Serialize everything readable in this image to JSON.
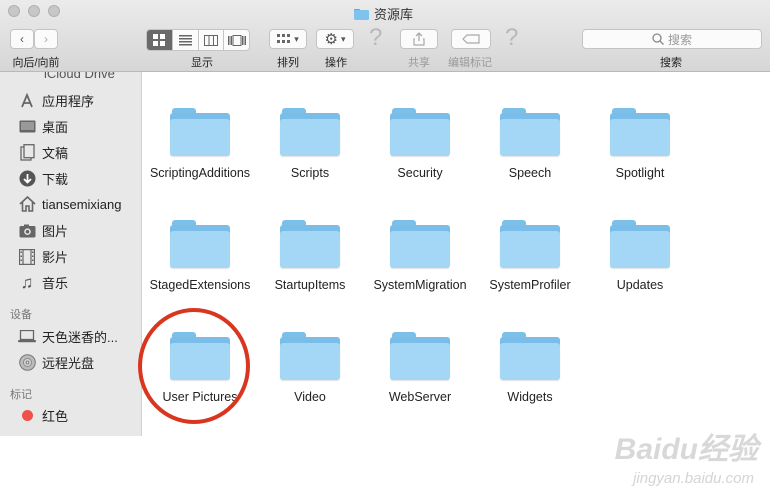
{
  "window": {
    "title": "资源库"
  },
  "toolbar": {
    "back_forward_label": "向后/向前",
    "view_label": "显示",
    "arrange_label": "排列",
    "action_label": "操作",
    "share_label": "共享",
    "edit_tags_label": "编辑标记",
    "search_label": "搜索",
    "search_placeholder": "搜索"
  },
  "sidebar": {
    "partial_top": "iCloud Drive",
    "favorites": [
      {
        "label": "应用程序",
        "icon": "applications-icon"
      },
      {
        "label": "桌面",
        "icon": "desktop-icon"
      },
      {
        "label": "文稿",
        "icon": "documents-icon"
      },
      {
        "label": "下载",
        "icon": "downloads-icon"
      },
      {
        "label": "tiansemixiang",
        "icon": "home-icon"
      },
      {
        "label": "图片",
        "icon": "pictures-icon"
      },
      {
        "label": "影片",
        "icon": "movies-icon"
      },
      {
        "label": "音乐",
        "icon": "music-icon"
      }
    ],
    "devices_header": "设备",
    "devices": [
      {
        "label": "天色迷香的...",
        "icon": "laptop-icon"
      },
      {
        "label": "远程光盘",
        "icon": "disc-icon"
      }
    ],
    "tags_header": "标记",
    "tags": [
      {
        "label": "红色",
        "color": "#f0504a"
      }
    ]
  },
  "folders": [
    [
      "ScriptingAdditions",
      "Scripts",
      "Security",
      "Speech",
      "Spotlight"
    ],
    [
      "StagedExtensions",
      "StartupItems",
      "SystemMigration",
      "SystemProfiler",
      "Updates"
    ],
    [
      "User Pictures",
      "Video",
      "WebServer",
      "Widgets"
    ]
  ],
  "highlight": {
    "folder": "User Pictures",
    "color": "#d9361f"
  },
  "watermark": {
    "logo": "Baidu经验",
    "url": "jingyan.baidu.com"
  }
}
